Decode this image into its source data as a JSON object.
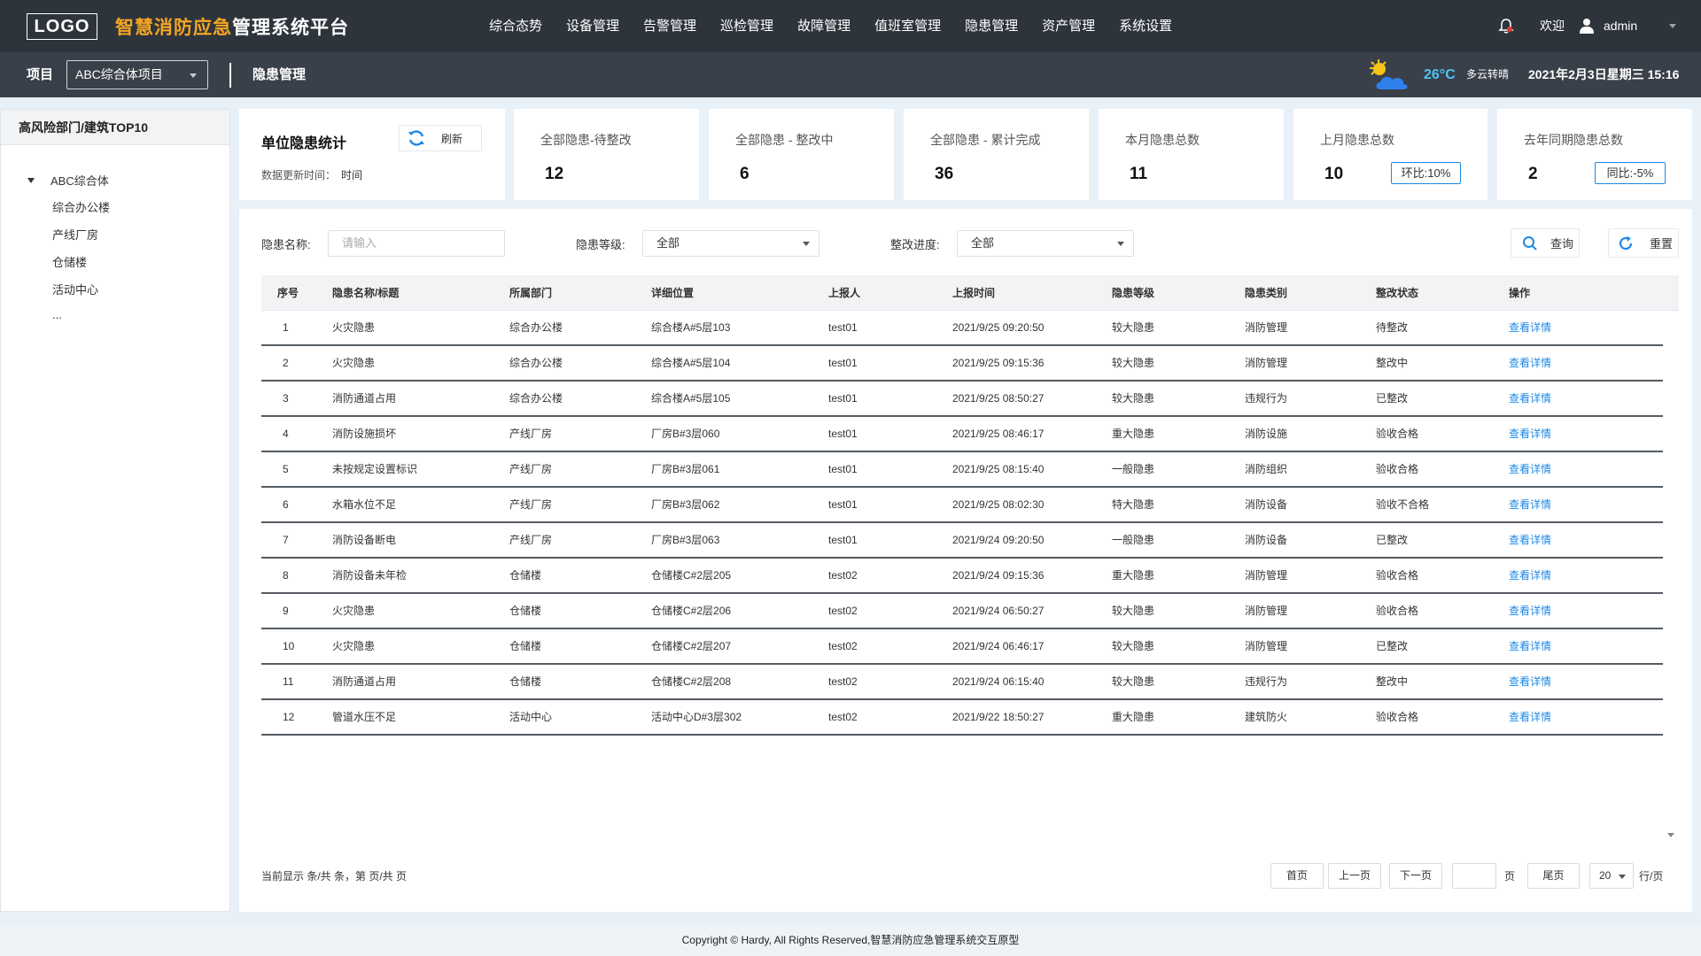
{
  "header": {
    "logo": "LOGO",
    "title_accent": "智慧消防应急",
    "title_rest": "管理系统平台",
    "menu": [
      "综合态势",
      "设备管理",
      "告警管理",
      "巡检管理",
      "故障管理",
      "值班室管理",
      "隐患管理",
      "资产管理",
      "系统设置"
    ],
    "welcome": "欢迎",
    "username": "admin"
  },
  "subbar": {
    "project_label": "项目",
    "project_value": "ABC综合体项目",
    "breadcrumb": "隐患管理",
    "weather_icon": "sun-cloud-icon",
    "temperature": "26°C",
    "weather_desc": "多云转晴",
    "datetime": "2021年2月3日星期三 15:16"
  },
  "sidebar": {
    "title": "高风险部门/建筑TOP10",
    "root": "ABC综合体",
    "children": [
      "综合办公楼",
      "产线厂房",
      "仓储楼",
      "活动中心",
      "..."
    ]
  },
  "unit_stats": {
    "title": "单位隐患统计",
    "refresh_label": "刷新",
    "update_label": "数据更新时间：",
    "update_value": "时间"
  },
  "stat_cards": [
    {
      "title": "全部隐患-待整改",
      "value": "12",
      "badge": ""
    },
    {
      "title": "全部隐患 - 整改中",
      "value": "6",
      "badge": ""
    },
    {
      "title": "全部隐患 - 累计完成",
      "value": "36",
      "badge": ""
    },
    {
      "title": "本月隐患总数",
      "value": "11",
      "badge": ""
    },
    {
      "title": "上月隐患总数",
      "value": "10",
      "badge": "环比:10%"
    },
    {
      "title": "去年同期隐患总数",
      "value": "2",
      "badge": "同比:-5%"
    }
  ],
  "filters": {
    "name_label": "隐患名称:",
    "name_placeholder": "请输入",
    "level_label": "隐患等级:",
    "level_value": "全部",
    "progress_label": "整改进度:",
    "progress_value": "全部",
    "query_label": "查询",
    "reset_label": "重置"
  },
  "table": {
    "headers": [
      "序号",
      "隐患名称/标题",
      "所属部门",
      "详细位置",
      "上报人",
      "上报时间",
      "隐患等级",
      "隐患类别",
      "整改状态",
      "操作"
    ],
    "rows": [
      [
        "1",
        "火灾隐患",
        "综合办公楼",
        "综合楼A#5层103",
        "test01",
        "2021/9/25 09:20:50",
        "较大隐患",
        "消防管理",
        "待整改",
        "查看详情"
      ],
      [
        "2",
        "火灾隐患",
        "综合办公楼",
        "综合楼A#5层104",
        "test01",
        "2021/9/25 09:15:36",
        "较大隐患",
        "消防管理",
        "整改中",
        "查看详情"
      ],
      [
        "3",
        "消防通道占用",
        "综合办公楼",
        "综合楼A#5层105",
        "test01",
        "2021/9/25 08:50:27",
        "较大隐患",
        "违规行为",
        "已整改",
        "查看详情"
      ],
      [
        "4",
        "消防设施损坏",
        "产线厂房",
        "厂房B#3层060",
        "test01",
        "2021/9/25 08:46:17",
        "重大隐患",
        "消防设施",
        "验收合格",
        "查看详情"
      ],
      [
        "5",
        "未按规定设置标识",
        "产线厂房",
        "厂房B#3层061",
        "test01",
        "2021/9/25 08:15:40",
        "一般隐患",
        "消防组织",
        "验收合格",
        "查看详情"
      ],
      [
        "6",
        "水箱水位不足",
        "产线厂房",
        "厂房B#3层062",
        "test01",
        "2021/9/25 08:02:30",
        "特大隐患",
        "消防设备",
        "验收不合格",
        "查看详情"
      ],
      [
        "7",
        "消防设备断电",
        "产线厂房",
        "厂房B#3层063",
        "test01",
        "2021/9/24 09:20:50",
        "一般隐患",
        "消防设备",
        "已整改",
        "查看详情"
      ],
      [
        "8",
        "消防设备未年检",
        "仓储楼",
        "仓储楼C#2层205",
        "test02",
        "2021/9/24 09:15:36",
        "重大隐患",
        "消防管理",
        "验收合格",
        "查看详情"
      ],
      [
        "9",
        "火灾隐患",
        "仓储楼",
        "仓储楼C#2层206",
        "test02",
        "2021/9/24 06:50:27",
        "较大隐患",
        "消防管理",
        "验收合格",
        "查看详情"
      ],
      [
        "10",
        "火灾隐患",
        "仓储楼",
        "仓储楼C#2层207",
        "test02",
        "2021/9/24 06:46:17",
        "较大隐患",
        "消防管理",
        "已整改",
        "查看详情"
      ],
      [
        "11",
        "消防通道占用",
        "仓储楼",
        "仓储楼C#2层208",
        "test02",
        "2021/9/24 06:15:40",
        "较大隐患",
        "违规行为",
        "整改中",
        "查看详情"
      ],
      [
        "12",
        "管道水压不足",
        "活动中心",
        "活动中心D#3层302",
        "test02",
        "2021/9/22 18:50:27",
        "重大隐患",
        "建筑防火",
        "验收合格",
        "查看详情"
      ]
    ]
  },
  "pagination": {
    "info": "当前显示  条/共  条，第 页/共 页",
    "first": "首页",
    "prev": "上一页",
    "next": "下一页",
    "page_suffix": "页",
    "last": "尾页",
    "page_size": "20",
    "per_page_suffix": "行/页"
  },
  "footer": {
    "copyright": "Copyright © Hardy, All Rights Reserved,智慧消防应急管理系统交互原型"
  },
  "colors": {
    "nav_bg": "#2e343c",
    "subbar_bg": "#3a4049",
    "accent_orange": "#f5a623",
    "link_blue": "#1e88e5",
    "temp_cyan": "#4fc3f7"
  }
}
